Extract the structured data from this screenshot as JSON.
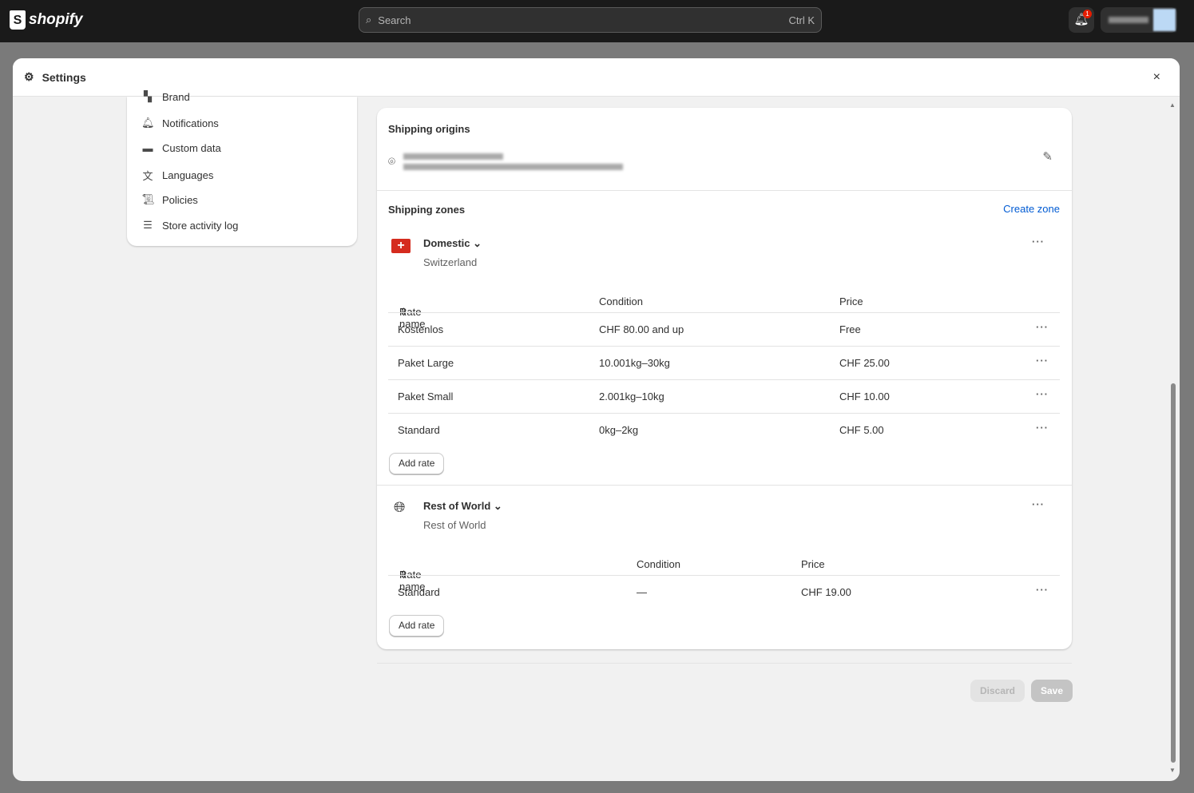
{
  "topbar": {
    "logo": "shopify",
    "search_placeholder": "Search",
    "search_shortcut": "Ctrl K",
    "notification_count": "1"
  },
  "modal": {
    "title": "Settings",
    "close": "×"
  },
  "sidebar": {
    "items": [
      {
        "label": "Brand",
        "icon": "brand-icon"
      },
      {
        "label": "Notifications",
        "icon": "bell-icon"
      },
      {
        "label": "Custom data",
        "icon": "custom-data-icon"
      },
      {
        "label": "Languages",
        "icon": "languages-icon"
      },
      {
        "label": "Policies",
        "icon": "policies-icon"
      },
      {
        "label": "Store activity log",
        "icon": "list-icon"
      }
    ]
  },
  "shipping": {
    "origins_title": "Shipping origins",
    "zones_title": "Shipping zones",
    "create_zone": "Create zone",
    "zones": [
      {
        "name": "Domestic",
        "region": "Switzerland",
        "headers": [
          "Rate name",
          "Condition",
          "Price"
        ],
        "rates": [
          [
            "Kostenlos",
            "CHF 80.00 and up",
            "Free"
          ],
          [
            "Paket Large",
            "10.001kg–30kg",
            "CHF 25.00"
          ],
          [
            "Paket Small",
            "2.001kg–10kg",
            "CHF 10.00"
          ],
          [
            "Standard",
            "0kg–2kg",
            "CHF 5.00"
          ]
        ],
        "add_rate": "Add rate"
      },
      {
        "name": "Rest of World",
        "region": "Rest of World",
        "headers": [
          "Rate name",
          "Condition",
          "Price"
        ],
        "rates": [
          [
            "Standard",
            "—",
            "CHF 19.00"
          ]
        ],
        "add_rate": "Add rate"
      }
    ]
  },
  "footer": {
    "discard": "Discard",
    "save": "Save"
  },
  "colors": {
    "accent": "#005bd3",
    "topbar": "#1a1a1a",
    "swiss_red": "#d52b1e"
  }
}
